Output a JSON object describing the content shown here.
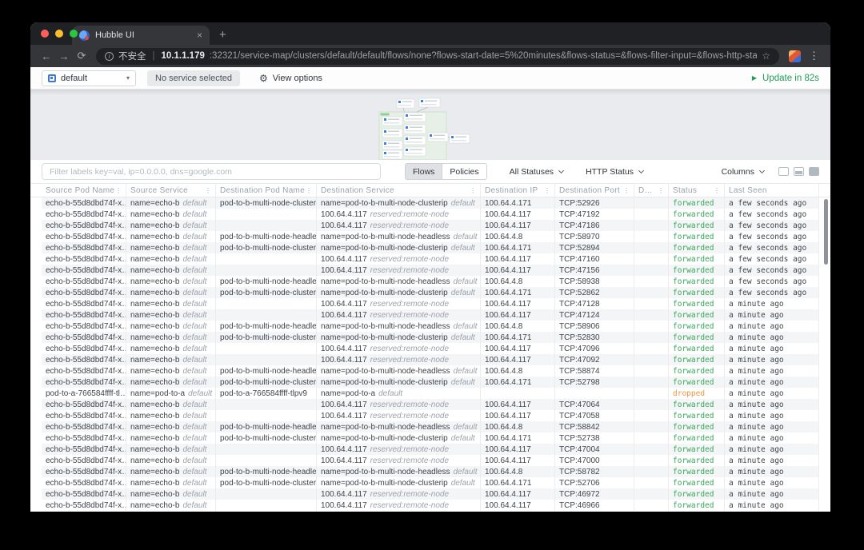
{
  "browser": {
    "tab_title": "Hubble UI",
    "security_label": "不安全",
    "url_host": "10.1.1.179",
    "url_path": ":32321/service-map/clusters/default/default/flows/none?flows-start-date=5%20minutes&flows-status=&flows-filter-input=&flows-http-status-code="
  },
  "icons": {
    "back": "←",
    "forward": "→",
    "reload": "⟳",
    "info": "i",
    "star": "☆",
    "menu_dots": "⋮",
    "tab_close": "×",
    "new_tab": "+",
    "caret_down": "▾",
    "gear": "⚙",
    "play": "▶",
    "column_menu": "⋮"
  },
  "toolbar": {
    "namespace": "default",
    "no_service": "No service selected",
    "view_options": "View options",
    "update": "Update in 82s"
  },
  "filterbar": {
    "placeholder": "Filter labels key=val, ip=0.0.0.0, dns=google.com",
    "tabs": [
      "Flows",
      "Policies"
    ],
    "all_statuses": "All Statuses",
    "http_status": "HTTP Status",
    "columns": "Columns"
  },
  "colors": {
    "forwarded": "#37a659",
    "dropped": "#f0953f",
    "update_green": "#1d9e55",
    "header_dots_blue": "#6b9fd8"
  },
  "table": {
    "headers": [
      "Source Pod Name",
      "Source Service",
      "Destination Pod Name",
      "Destination Service",
      "Destination IP",
      "Destination Port",
      "D…",
      "Status",
      "Last Seen"
    ],
    "rows": [
      {
        "source_pod": "echo-b-55d8dbd74f-x…",
        "source_service": "name=echo-b",
        "source_label": "default",
        "dest_pod": "pod-to-b-multi-node-cluster…",
        "dest_service": "name=pod-to-b-multi-node-clusterip",
        "dest_label": "default",
        "dest_ip": "100.64.4.171",
        "dest_port": "TCP:52926",
        "l7": "",
        "status": "forwarded",
        "last_seen": "a few seconds ago"
      },
      {
        "source_pod": "echo-b-55d8dbd74f-x…",
        "source_service": "name=echo-b",
        "source_label": "default",
        "dest_pod": "",
        "dest_service": "100.64.4.117",
        "dest_label": "reserved:remote-node",
        "dest_ip": "100.64.4.117",
        "dest_port": "TCP:47192",
        "l7": "",
        "status": "forwarded",
        "last_seen": "a few seconds ago"
      },
      {
        "source_pod": "echo-b-55d8dbd74f-x…",
        "source_service": "name=echo-b",
        "source_label": "default",
        "dest_pod": "",
        "dest_service": "100.64.4.117",
        "dest_label": "reserved:remote-node",
        "dest_ip": "100.64.4.117",
        "dest_port": "TCP:47186",
        "l7": "",
        "status": "forwarded",
        "last_seen": "a few seconds ago"
      },
      {
        "source_pod": "echo-b-55d8dbd74f-x…",
        "source_service": "name=echo-b",
        "source_label": "default",
        "dest_pod": "pod-to-b-multi-node-headle…",
        "dest_service": "name=pod-to-b-multi-node-headless",
        "dest_label": "default",
        "dest_ip": "100.64.4.8",
        "dest_port": "TCP:58970",
        "l7": "",
        "status": "forwarded",
        "last_seen": "a few seconds ago"
      },
      {
        "source_pod": "echo-b-55d8dbd74f-x…",
        "source_service": "name=echo-b",
        "source_label": "default",
        "dest_pod": "pod-to-b-multi-node-cluster…",
        "dest_service": "name=pod-to-b-multi-node-clusterip",
        "dest_label": "default",
        "dest_ip": "100.64.4.171",
        "dest_port": "TCP:52894",
        "l7": "",
        "status": "forwarded",
        "last_seen": "a few seconds ago"
      },
      {
        "source_pod": "echo-b-55d8dbd74f-x…",
        "source_service": "name=echo-b",
        "source_label": "default",
        "dest_pod": "",
        "dest_service": "100.64.4.117",
        "dest_label": "reserved:remote-node",
        "dest_ip": "100.64.4.117",
        "dest_port": "TCP:47160",
        "l7": "",
        "status": "forwarded",
        "last_seen": "a few seconds ago"
      },
      {
        "source_pod": "echo-b-55d8dbd74f-x…",
        "source_service": "name=echo-b",
        "source_label": "default",
        "dest_pod": "",
        "dest_service": "100.64.4.117",
        "dest_label": "reserved:remote-node",
        "dest_ip": "100.64.4.117",
        "dest_port": "TCP:47156",
        "l7": "",
        "status": "forwarded",
        "last_seen": "a few seconds ago"
      },
      {
        "source_pod": "echo-b-55d8dbd74f-x…",
        "source_service": "name=echo-b",
        "source_label": "default",
        "dest_pod": "pod-to-b-multi-node-headle…",
        "dest_service": "name=pod-to-b-multi-node-headless",
        "dest_label": "default",
        "dest_ip": "100.64.4.8",
        "dest_port": "TCP:58938",
        "l7": "",
        "status": "forwarded",
        "last_seen": "a few seconds ago"
      },
      {
        "source_pod": "echo-b-55d8dbd74f-x…",
        "source_service": "name=echo-b",
        "source_label": "default",
        "dest_pod": "pod-to-b-multi-node-cluster…",
        "dest_service": "name=pod-to-b-multi-node-clusterip",
        "dest_label": "default",
        "dest_ip": "100.64.4.171",
        "dest_port": "TCP:52862",
        "l7": "",
        "status": "forwarded",
        "last_seen": "a few seconds ago"
      },
      {
        "source_pod": "echo-b-55d8dbd74f-x…",
        "source_service": "name=echo-b",
        "source_label": "default",
        "dest_pod": "",
        "dest_service": "100.64.4.117",
        "dest_label": "reserved:remote-node",
        "dest_ip": "100.64.4.117",
        "dest_port": "TCP:47128",
        "l7": "",
        "status": "forwarded",
        "last_seen": "a minute ago"
      },
      {
        "source_pod": "echo-b-55d8dbd74f-x…",
        "source_service": "name=echo-b",
        "source_label": "default",
        "dest_pod": "",
        "dest_service": "100.64.4.117",
        "dest_label": "reserved:remote-node",
        "dest_ip": "100.64.4.117",
        "dest_port": "TCP:47124",
        "l7": "",
        "status": "forwarded",
        "last_seen": "a minute ago"
      },
      {
        "source_pod": "echo-b-55d8dbd74f-x…",
        "source_service": "name=echo-b",
        "source_label": "default",
        "dest_pod": "pod-to-b-multi-node-headle…",
        "dest_service": "name=pod-to-b-multi-node-headless",
        "dest_label": "default",
        "dest_ip": "100.64.4.8",
        "dest_port": "TCP:58906",
        "l7": "",
        "status": "forwarded",
        "last_seen": "a minute ago"
      },
      {
        "source_pod": "echo-b-55d8dbd74f-x…",
        "source_service": "name=echo-b",
        "source_label": "default",
        "dest_pod": "pod-to-b-multi-node-cluster…",
        "dest_service": "name=pod-to-b-multi-node-clusterip",
        "dest_label": "default",
        "dest_ip": "100.64.4.171",
        "dest_port": "TCP:52830",
        "l7": "",
        "status": "forwarded",
        "last_seen": "a minute ago"
      },
      {
        "source_pod": "echo-b-55d8dbd74f-x…",
        "source_service": "name=echo-b",
        "source_label": "default",
        "dest_pod": "",
        "dest_service": "100.64.4.117",
        "dest_label": "reserved:remote-node",
        "dest_ip": "100.64.4.117",
        "dest_port": "TCP:47096",
        "l7": "",
        "status": "forwarded",
        "last_seen": "a minute ago"
      },
      {
        "source_pod": "echo-b-55d8dbd74f-x…",
        "source_service": "name=echo-b",
        "source_label": "default",
        "dest_pod": "",
        "dest_service": "100.64.4.117",
        "dest_label": "reserved:remote-node",
        "dest_ip": "100.64.4.117",
        "dest_port": "TCP:47092",
        "l7": "",
        "status": "forwarded",
        "last_seen": "a minute ago"
      },
      {
        "source_pod": "echo-b-55d8dbd74f-x…",
        "source_service": "name=echo-b",
        "source_label": "default",
        "dest_pod": "pod-to-b-multi-node-headle…",
        "dest_service": "name=pod-to-b-multi-node-headless",
        "dest_label": "default",
        "dest_ip": "100.64.4.8",
        "dest_port": "TCP:58874",
        "l7": "",
        "status": "forwarded",
        "last_seen": "a minute ago"
      },
      {
        "source_pod": "echo-b-55d8dbd74f-x…",
        "source_service": "name=echo-b",
        "source_label": "default",
        "dest_pod": "pod-to-b-multi-node-cluster…",
        "dest_service": "name=pod-to-b-multi-node-clusterip",
        "dest_label": "default",
        "dest_ip": "100.64.4.171",
        "dest_port": "TCP:52798",
        "l7": "",
        "status": "forwarded",
        "last_seen": "a minute ago"
      },
      {
        "source_pod": "pod-to-a-766584ffff-tl…",
        "source_service": "name=pod-to-a",
        "source_label": "default",
        "dest_pod": "pod-to-a-766584ffff-tlpv9",
        "dest_service": "name=pod-to-a",
        "dest_label": "default",
        "dest_ip": "",
        "dest_port": "",
        "l7": "",
        "status": "dropped",
        "last_seen": "a minute ago"
      },
      {
        "source_pod": "echo-b-55d8dbd74f-x…",
        "source_service": "name=echo-b",
        "source_label": "default",
        "dest_pod": "",
        "dest_service": "100.64.4.117",
        "dest_label": "reserved:remote-node",
        "dest_ip": "100.64.4.117",
        "dest_port": "TCP:47064",
        "l7": "",
        "status": "forwarded",
        "last_seen": "a minute ago"
      },
      {
        "source_pod": "echo-b-55d8dbd74f-x…",
        "source_service": "name=echo-b",
        "source_label": "default",
        "dest_pod": "",
        "dest_service": "100.64.4.117",
        "dest_label": "reserved:remote-node",
        "dest_ip": "100.64.4.117",
        "dest_port": "TCP:47058",
        "l7": "",
        "status": "forwarded",
        "last_seen": "a minute ago"
      },
      {
        "source_pod": "echo-b-55d8dbd74f-x…",
        "source_service": "name=echo-b",
        "source_label": "default",
        "dest_pod": "pod-to-b-multi-node-headle…",
        "dest_service": "name=pod-to-b-multi-node-headless",
        "dest_label": "default",
        "dest_ip": "100.64.4.8",
        "dest_port": "TCP:58842",
        "l7": "",
        "status": "forwarded",
        "last_seen": "a minute ago"
      },
      {
        "source_pod": "echo-b-55d8dbd74f-x…",
        "source_service": "name=echo-b",
        "source_label": "default",
        "dest_pod": "pod-to-b-multi-node-cluster…",
        "dest_service": "name=pod-to-b-multi-node-clusterip",
        "dest_label": "default",
        "dest_ip": "100.64.4.171",
        "dest_port": "TCP:52738",
        "l7": "",
        "status": "forwarded",
        "last_seen": "a minute ago"
      },
      {
        "source_pod": "echo-b-55d8dbd74f-x…",
        "source_service": "name=echo-b",
        "source_label": "default",
        "dest_pod": "",
        "dest_service": "100.64.4.117",
        "dest_label": "reserved:remote-node",
        "dest_ip": "100.64.4.117",
        "dest_port": "TCP:47004",
        "l7": "",
        "status": "forwarded",
        "last_seen": "a minute ago"
      },
      {
        "source_pod": "echo-b-55d8dbd74f-x…",
        "source_service": "name=echo-b",
        "source_label": "default",
        "dest_pod": "",
        "dest_service": "100.64.4.117",
        "dest_label": "reserved:remote-node",
        "dest_ip": "100.64.4.117",
        "dest_port": "TCP:47000",
        "l7": "",
        "status": "forwarded",
        "last_seen": "a minute ago"
      },
      {
        "source_pod": "echo-b-55d8dbd74f-x…",
        "source_service": "name=echo-b",
        "source_label": "default",
        "dest_pod": "pod-to-b-multi-node-headle…",
        "dest_service": "name=pod-to-b-multi-node-headless",
        "dest_label": "default",
        "dest_ip": "100.64.4.8",
        "dest_port": "TCP:58782",
        "l7": "",
        "status": "forwarded",
        "last_seen": "a minute ago"
      },
      {
        "source_pod": "echo-b-55d8dbd74f-x…",
        "source_service": "name=echo-b",
        "source_label": "default",
        "dest_pod": "pod-to-b-multi-node-cluster…",
        "dest_service": "name=pod-to-b-multi-node-clusterip",
        "dest_label": "default",
        "dest_ip": "100.64.4.171",
        "dest_port": "TCP:52706",
        "l7": "",
        "status": "forwarded",
        "last_seen": "a minute ago"
      },
      {
        "source_pod": "echo-b-55d8dbd74f-x…",
        "source_service": "name=echo-b",
        "source_label": "default",
        "dest_pod": "",
        "dest_service": "100.64.4.117",
        "dest_label": "reserved:remote-node",
        "dest_ip": "100.64.4.117",
        "dest_port": "TCP:46972",
        "l7": "",
        "status": "forwarded",
        "last_seen": "a minute ago"
      },
      {
        "source_pod": "echo-b-55d8dbd74f-x…",
        "source_service": "name=echo-b",
        "source_label": "default",
        "dest_pod": "",
        "dest_service": "100.64.4.117",
        "dest_label": "reserved:remote-node",
        "dest_ip": "100.64.4.117",
        "dest_port": "TCP:46966",
        "l7": "",
        "status": "forwarded",
        "last_seen": "a minute ago"
      }
    ]
  }
}
